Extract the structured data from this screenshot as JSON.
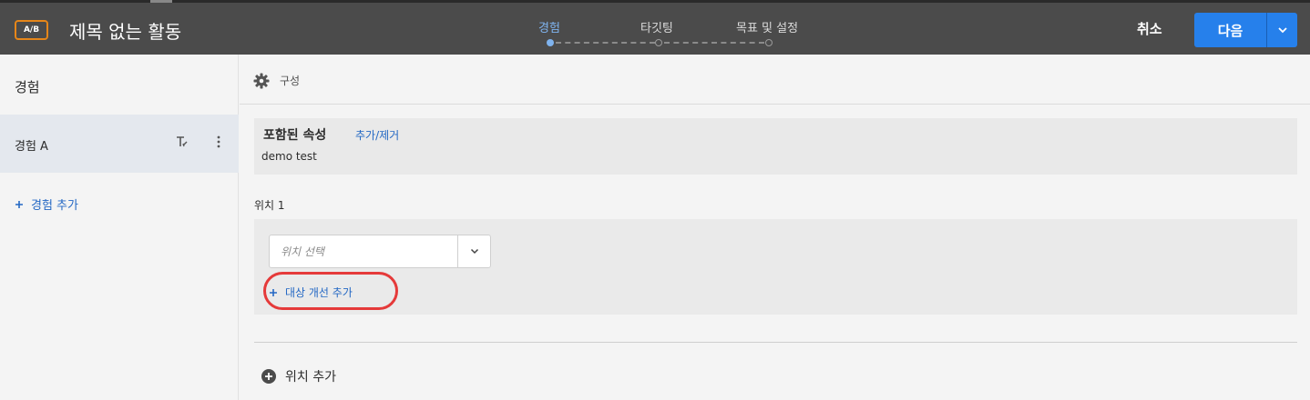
{
  "header": {
    "badge": "A/B",
    "title": "제목 없는 활동",
    "steps": [
      {
        "label": "경험",
        "active": true
      },
      {
        "label": "타깃팅",
        "active": false
      },
      {
        "label": "목표 및 설정",
        "active": false
      }
    ],
    "cancel_label": "취소",
    "next_label": "다음"
  },
  "sidebar": {
    "title": "경험",
    "experience_item": "경험 A",
    "add_experience": "경험 추가"
  },
  "main": {
    "compose_label": "구성",
    "included_attributes": {
      "title": "포함된 속성",
      "link": "추가/제거",
      "value": "demo test"
    },
    "position": {
      "label": "위치 1",
      "select_placeholder": "위치 선택",
      "add_audience": "대상 개선 추가"
    },
    "add_position": "위치 추가"
  },
  "colors": {
    "header_bg": "#4b4b4b",
    "accent_blue": "#2680eb",
    "link_blue": "#2468c4",
    "badge_orange": "#e68619",
    "highlight_red": "#e53a3a"
  },
  "icons": [
    "gear-icon",
    "rename-icon",
    "more-icon",
    "chevron-down-icon",
    "plus-icon",
    "plus-circle-icon"
  ]
}
